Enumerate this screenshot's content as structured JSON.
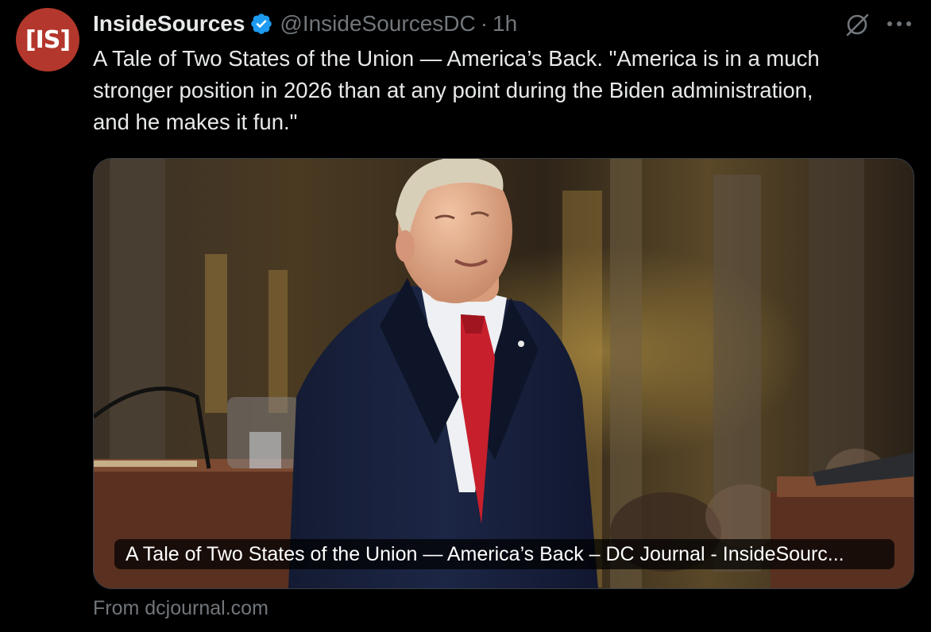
{
  "avatar": {
    "text": "[IS]",
    "bg_color": "#b3372c"
  },
  "author": {
    "display_name": "InsideSources",
    "verified_icon": "verified-badge-icon",
    "handle": "@InsideSourcesDC",
    "separator": "·",
    "time": "1h"
  },
  "actions": {
    "grok_icon": "grok-icon",
    "more_icon": "more-options-icon"
  },
  "tweet": {
    "text": "A Tale of Two States of the Union — America’s Back. \"America is in a much\nstronger position in 2026 than at any point during the Biden administration,\nand he makes it fun.\""
  },
  "card": {
    "caption": "A Tale of Two States of the Union — America’s Back – DC Journal - InsideSourc...",
    "source": "From dcjournal.com"
  },
  "colors": {
    "background": "#000000",
    "text_primary": "#e7e9ea",
    "text_secondary": "#71767b",
    "verified_blue": "#1d9bf0"
  }
}
